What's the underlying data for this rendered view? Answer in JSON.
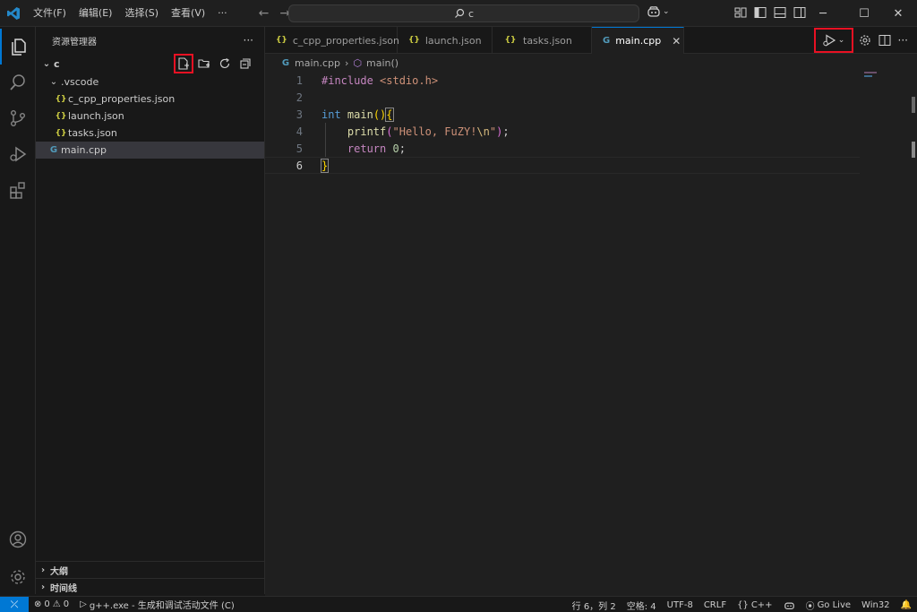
{
  "titlebar": {
    "menu": [
      "文件(F)",
      "编辑(E)",
      "选择(S)",
      "查看(V)",
      "···"
    ],
    "search_text": "c",
    "window_controls": [
      "minimize-icon",
      "maximize-icon",
      "close-icon"
    ]
  },
  "sidebar": {
    "header": "资源管理器",
    "more": "···",
    "root_folder": "c",
    "tree": [
      {
        "label": ".vscode",
        "kind": "folder",
        "indent": 1
      },
      {
        "label": "c_cpp_properties.json",
        "kind": "json",
        "indent": 2
      },
      {
        "label": "launch.json",
        "kind": "json",
        "indent": 2
      },
      {
        "label": "tasks.json",
        "kind": "json",
        "indent": 2
      },
      {
        "label": "main.cpp",
        "kind": "cpp",
        "indent": 1,
        "selected": true
      }
    ],
    "sections": [
      "大纲",
      "时间线"
    ]
  },
  "tabs": [
    {
      "label": "c_cpp_properties.json",
      "kind": "json",
      "active": false
    },
    {
      "label": "launch.json",
      "kind": "json",
      "active": false
    },
    {
      "label": "tasks.json",
      "kind": "json",
      "active": false
    },
    {
      "label": "main.cpp",
      "kind": "cpp",
      "active": true
    }
  ],
  "breadcrumb": {
    "file": "main.cpp",
    "symbol": "main()"
  },
  "editor": {
    "current_line": 6,
    "line_numbers": [
      "1",
      "2",
      "3",
      "4",
      "5",
      "6"
    ],
    "lines": [
      "#include <stdio.h>",
      "",
      "int main(){",
      "    printf(\"Hello, FuZY!\\n\");",
      "    return 0;",
      "}"
    ]
  },
  "statusbar": {
    "errors": "0",
    "warnings": "0",
    "debug_task": "g++.exe - 生成和调试活动文件 (C)",
    "position": "行 6，列 2",
    "spaces": "空格: 4",
    "encoding": "UTF-8",
    "eol": "CRLF",
    "language": "C++",
    "golive": "Go Live",
    "platform": "Win32"
  },
  "colors": {
    "accent": "#0078d4",
    "highlight_box": "#e81123",
    "json_icon": "#cbcb41",
    "cpp_icon": "#519aba"
  }
}
